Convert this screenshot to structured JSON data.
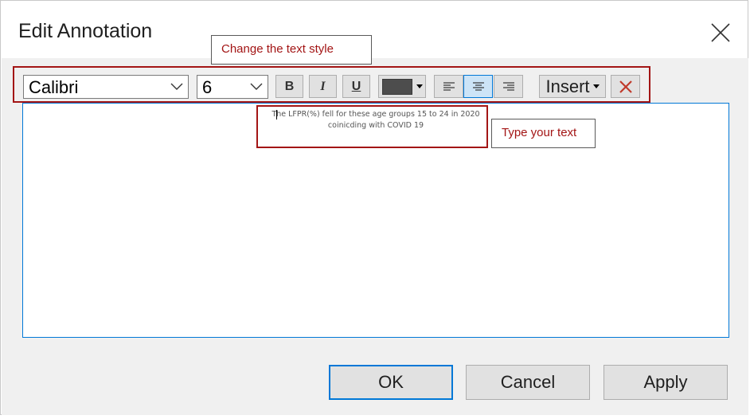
{
  "window": {
    "title": "Edit Annotation"
  },
  "toolbar": {
    "font": "Calibri",
    "size": "6",
    "bold_label": "B",
    "italic_label": "I",
    "underline_label": "U",
    "text_color": "#4d4d4d",
    "align_selected": "center",
    "insert_label": "Insert"
  },
  "callouts": {
    "style_hint": "Change the text style",
    "type_hint": "Type your text"
  },
  "editor": {
    "text": "The LFPR(%) fell for these age groups 15 to 24 in 2020 coinicding with COVID 19"
  },
  "buttons": {
    "ok": "OK",
    "cancel": "Cancel",
    "apply": "Apply"
  },
  "colors": {
    "highlight": "#a31515",
    "accent": "#0078d7"
  }
}
